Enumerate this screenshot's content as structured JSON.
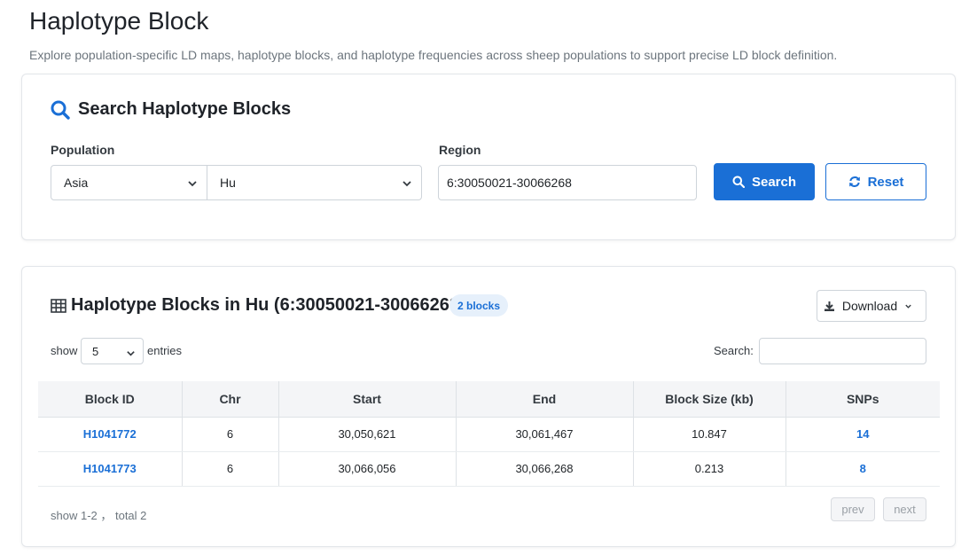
{
  "page": {
    "title": "Haplotype Block",
    "description": "Explore population-specific LD maps, haplotype blocks, and haplotype frequencies across sheep populations to support precise LD block definition."
  },
  "search_card": {
    "title": "Search Haplotype Blocks",
    "population_label": "Population",
    "continent_value": "Asia",
    "population_value": "Hu",
    "region_label": "Region",
    "region_value": "6:30050021-30066268",
    "search_button": "Search",
    "reset_button": "Reset"
  },
  "results_card": {
    "title": "Haplotype Blocks in Hu (6:30050021-30066268)",
    "badge": "2 blocks",
    "download_button": "Download",
    "show_label": "show",
    "entries_value": "5",
    "entries_label": "entries",
    "search_label": "Search:",
    "search_value": "",
    "columns": [
      "Block ID",
      "Chr",
      "Start",
      "End",
      "Block Size (kb)",
      "SNPs"
    ],
    "rows": [
      {
        "block_id": "H1041772",
        "chr": "6",
        "start": "30,050,621",
        "end": "30,061,467",
        "size": "10.847",
        "snps": "14"
      },
      {
        "block_id": "H1041773",
        "chr": "6",
        "start": "30,066,056",
        "end": "30,066,268",
        "size": "0.213",
        "snps": "8"
      }
    ],
    "footer_info": "show 1-2 ， total 2",
    "prev_button": "prev",
    "next_button": "next"
  },
  "colors": {
    "accent": "#1a6fd6",
    "badge_bg": "#e6f0fb",
    "table_header_bg": "#f4f5f7"
  },
  "icons": [
    "search-icon",
    "sync-icon",
    "table-icon",
    "download-icon",
    "chevron-down-icon"
  ]
}
